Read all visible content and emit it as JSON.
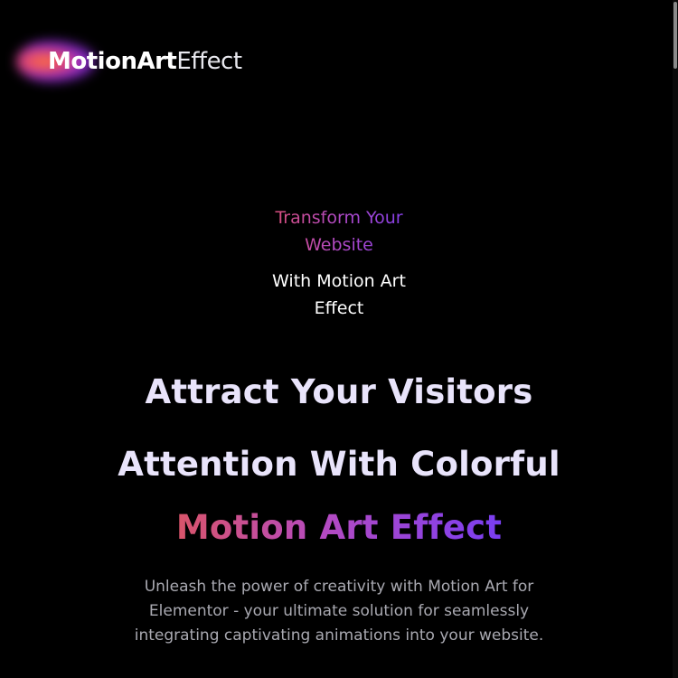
{
  "logo": {
    "bold": "MotionArt",
    "light": "Effect"
  },
  "hero": {
    "eyebrow_gradient": "Transform Your Website",
    "eyebrow_white": "With Motion Art Effect",
    "headline_line1": "Attract Your Visitors",
    "headline_line2": "Attention With Colorful",
    "headline_line3": "Motion Art Effect",
    "description": "Unleash the power of creativity with Motion Art for Elementor - your ultimate solution for seamlessly integrating captivating animations into your website."
  },
  "colors": {
    "background": "#000000",
    "gradient_start": "#e2506a",
    "gradient_mid": "#b14ac6",
    "gradient_end": "#7b3cf0",
    "headline": "#e9e4fb",
    "body_text": "#a9a9b1"
  }
}
